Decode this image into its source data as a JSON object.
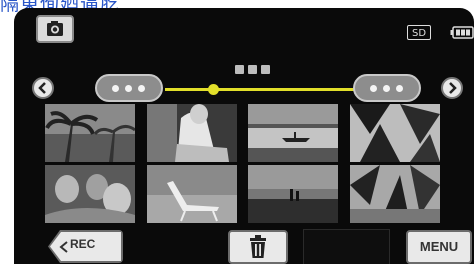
{
  "caption": "隔東侚廼逼肐",
  "header": {
    "mode_button_icon": "camera-icon",
    "sd_label": "SD",
    "battery_icon": "battery-icon"
  },
  "navigation": {
    "prev_icon": "chevron-left-icon",
    "next_icon": "chevron-right-icon",
    "page_indicator_dots": 3
  },
  "thumbnails": [
    {
      "subject": "palm trees"
    },
    {
      "subject": "person sitting"
    },
    {
      "subject": "boat on water"
    },
    {
      "subject": "tropical plant"
    },
    {
      "subject": "people on beach"
    },
    {
      "subject": "beach chair"
    },
    {
      "subject": "shoreline figures"
    },
    {
      "subject": "palm leaves"
    }
  ],
  "footer": {
    "rec_label": "REC",
    "rec_icon": "back-arrow-icon",
    "trash_icon": "trash-icon",
    "menu_label": "MENU"
  },
  "colors": {
    "accent_track": "#e2df2a",
    "caption_blue": "#2a56c8",
    "screen_bg": "#0a0a0a"
  }
}
